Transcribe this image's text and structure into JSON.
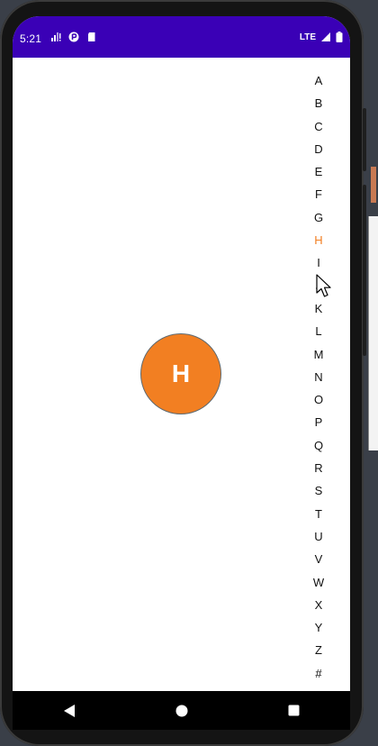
{
  "status_bar": {
    "time": "5:21",
    "network": "LTE",
    "background_color": "#3a00b6",
    "left_icons": [
      "signal-warning-icon",
      "p-icon",
      "sd-card-icon"
    ],
    "right_icons": [
      "lte-signal-icon",
      "battery-icon"
    ]
  },
  "index_bar": {
    "letters": [
      "A",
      "B",
      "C",
      "D",
      "E",
      "F",
      "G",
      "H",
      "I",
      "J",
      "K",
      "L",
      "M",
      "N",
      "O",
      "P",
      "Q",
      "R",
      "S",
      "T",
      "U",
      "V",
      "W",
      "X",
      "Y",
      "Z",
      "#"
    ],
    "active_letter": "H",
    "active_color": "#f27f22"
  },
  "bubble": {
    "letter": "H",
    "color": "#f27f22"
  },
  "nav_bar": {
    "buttons": [
      "back-icon",
      "home-icon",
      "recents-icon"
    ]
  }
}
